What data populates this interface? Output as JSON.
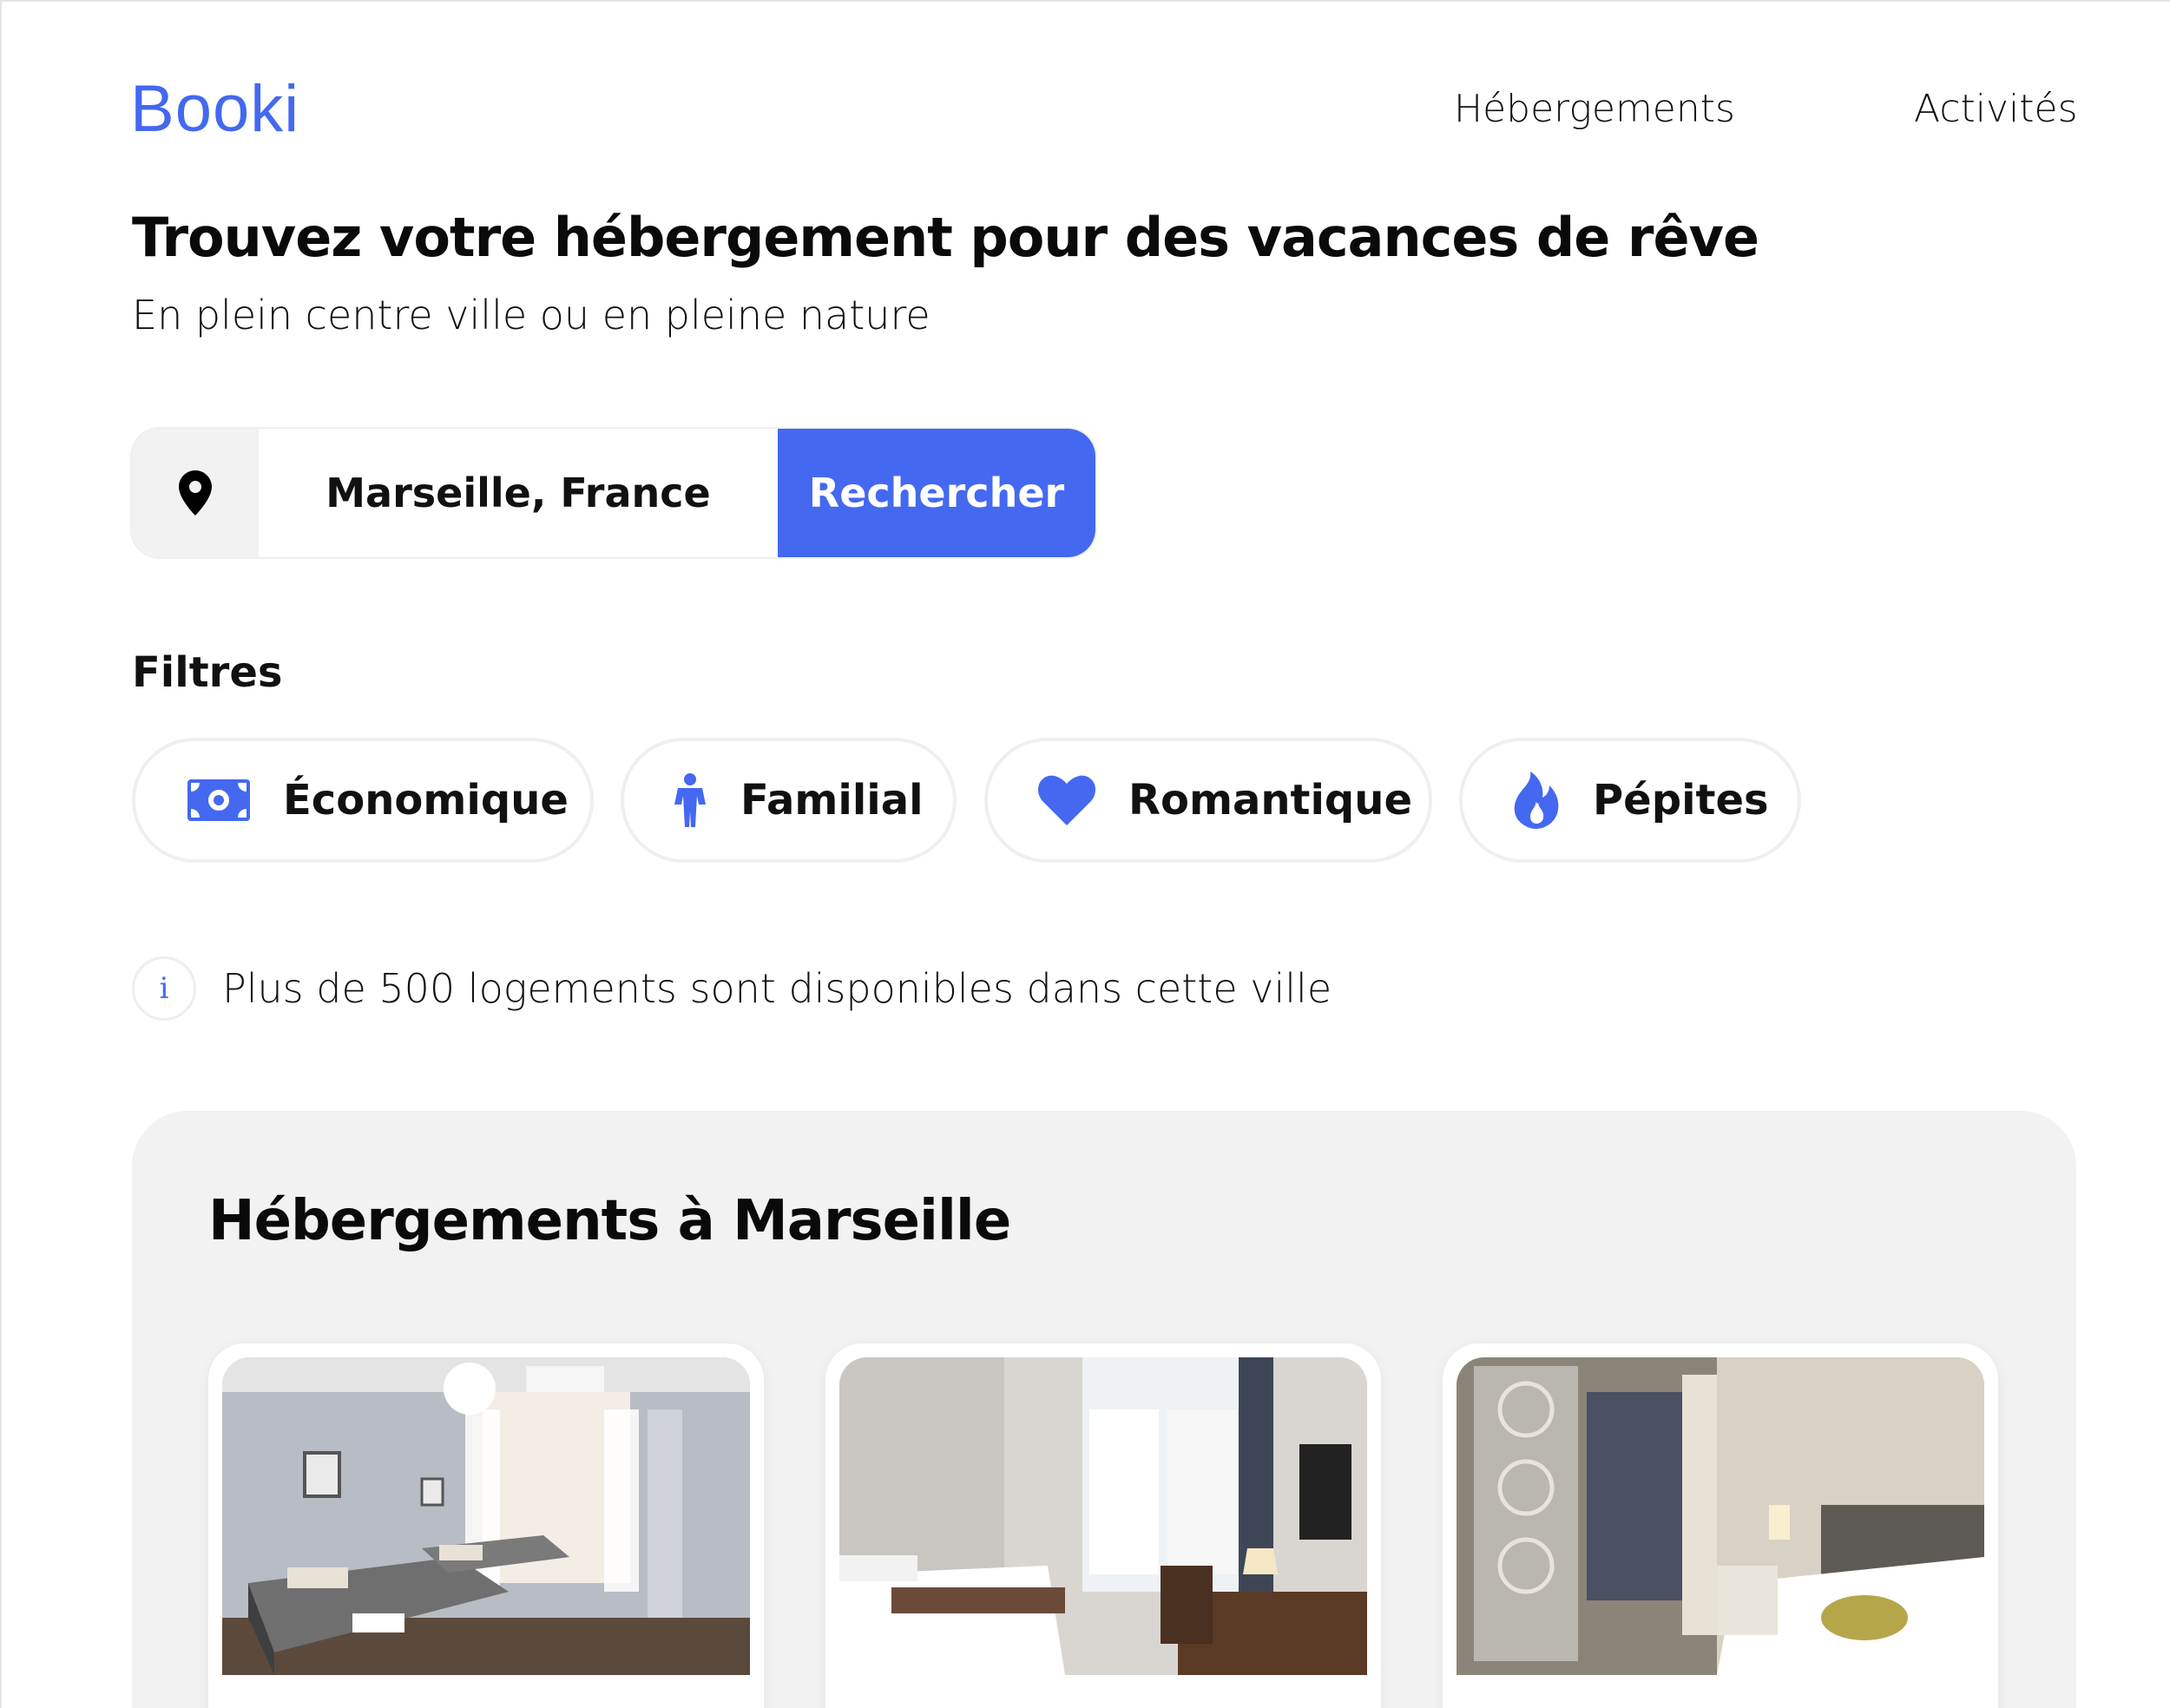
{
  "header": {
    "logo_text": "Booki",
    "nav": [
      {
        "label": "Hébergements"
      },
      {
        "label": "Activités"
      }
    ]
  },
  "hero": {
    "title": "Trouvez votre hébergement pour des vacances de rêve",
    "subtitle": "En plein centre ville ou en pleine nature"
  },
  "search": {
    "icon": "location-pin-icon",
    "value": "Marseille, France",
    "button_label": "Rechercher"
  },
  "filters": {
    "title": "Filtres",
    "items": [
      {
        "label": "Économique",
        "icon": "money-bill-icon"
      },
      {
        "label": "Familial",
        "icon": "person-icon"
      },
      {
        "label": "Romantique",
        "icon": "heart-icon"
      },
      {
        "label": "Pépites",
        "icon": "fire-icon"
      }
    ]
  },
  "info": {
    "icon": "info-icon",
    "text": "Plus de 500 logements sont disponibles dans cette ville"
  },
  "results": {
    "title": "Hébergements à Marseille",
    "cards": [
      {
        "image": "hotel-room-photo-1"
      },
      {
        "image": "hotel-room-photo-2"
      },
      {
        "image": "hotel-room-photo-3"
      }
    ]
  },
  "colors": {
    "accent": "#4468f0",
    "panel_background": "#f2f2f2",
    "text": "#111111"
  }
}
